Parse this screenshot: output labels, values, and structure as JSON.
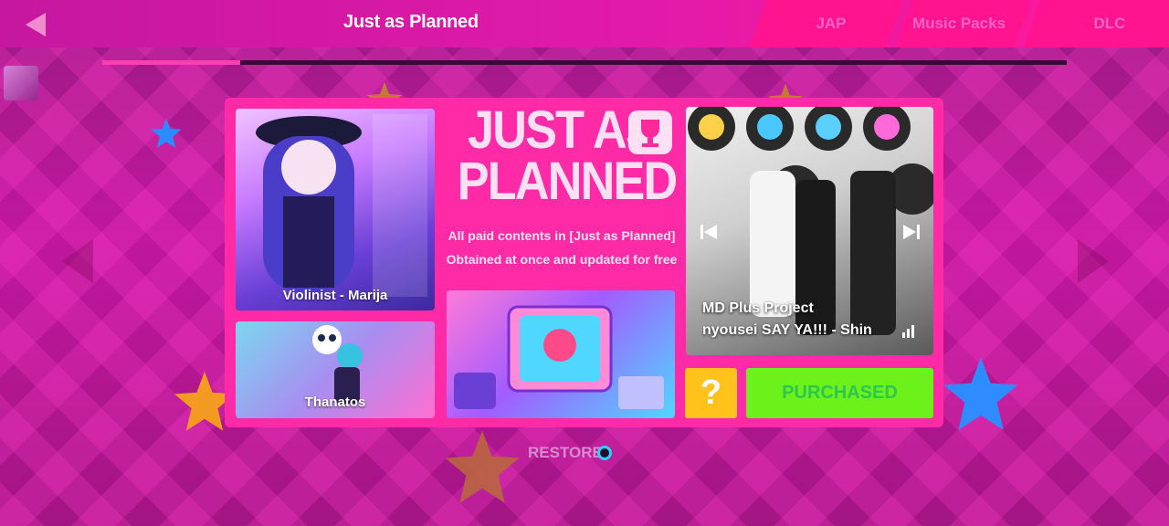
{
  "header": {
    "title": "Just as Planned"
  },
  "tabs": [
    {
      "label": "JAP"
    },
    {
      "label": "Music Packs"
    },
    {
      "label": "DLC"
    }
  ],
  "progress": {
    "fraction": 0.143
  },
  "pack": {
    "title_line1": "JUST AS",
    "title_line2": "PLANNED",
    "desc_line1": "All paid contents in [Just as Planned]",
    "desc_line2": "Obtained at once and updated for free"
  },
  "cards": {
    "marija_label": "Violinist - Marija",
    "thanatos_label": "Thanatos"
  },
  "song": {
    "line1": "MD Plus Project",
    "line2": "nyousei SAY YA!!! - Shin"
  },
  "buttons": {
    "help": "?",
    "purchased": "PURCHASED",
    "restore": "RESTORE"
  },
  "colors": {
    "panel": "#ff2aa6",
    "purchased": "#6cf21a",
    "help": "#ffc21a",
    "accent": "#2fd0ff"
  },
  "icons": [
    "back-arrow-icon",
    "trophy-icon",
    "previous-icon",
    "next-icon",
    "bars-icon",
    "star-icon"
  ]
}
